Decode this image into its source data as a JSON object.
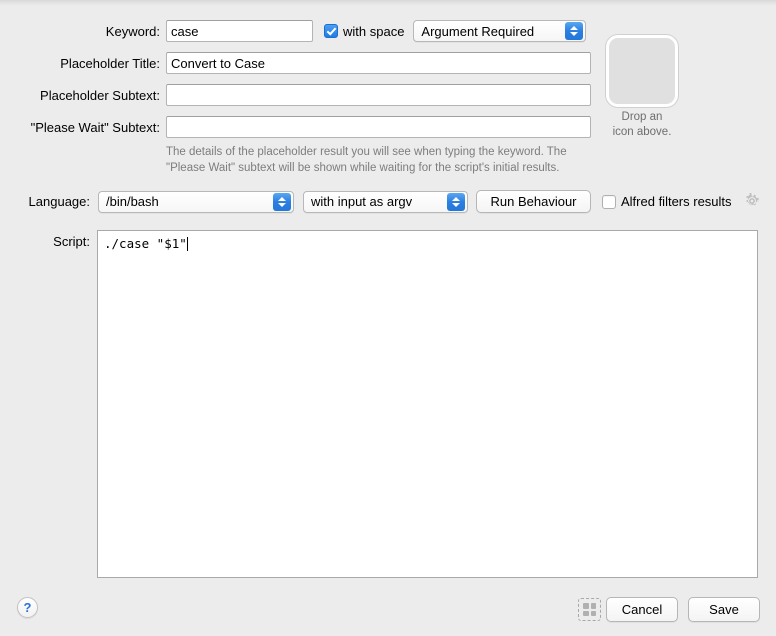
{
  "form": {
    "keyword": {
      "label": "Keyword:",
      "value": "case",
      "placeholder": ""
    },
    "with_space": {
      "label": "with space",
      "checked": true
    },
    "argument_mode": {
      "value": "Argument Required"
    },
    "placeholder_title": {
      "label": "Placeholder Title:",
      "value": "Convert to Case",
      "placeholder": ""
    },
    "placeholder_subtext": {
      "label": "Placeholder Subtext:",
      "value": "",
      "placeholder": ""
    },
    "please_wait_subtext": {
      "label": "\"Please Wait\" Subtext:",
      "value": "",
      "placeholder": ""
    },
    "help_text": "The details of the placeholder result you will see when typing the keyword. The\n\"Please Wait\" subtext will be shown while waiting for the script's initial results.",
    "language": {
      "label": "Language:",
      "value": "/bin/bash"
    },
    "input_mode": {
      "value": "with input as argv"
    },
    "run_behaviour": {
      "label": "Run Behaviour"
    },
    "alfred_filters": {
      "label": "Alfred filters results",
      "checked": false
    },
    "script": {
      "label": "Script:",
      "value": "./case \"$1\""
    }
  },
  "icon_well": {
    "caption": "Drop an\nicon above."
  },
  "footer": {
    "help_glyph": "?",
    "cancel_label": "Cancel",
    "save_label": "Save"
  },
  "colors": {
    "accent_blue": "#2b7fe0",
    "window_bg": "#ececec",
    "field_white": "#ffffff",
    "help_link_blue": "#2f72d6"
  }
}
